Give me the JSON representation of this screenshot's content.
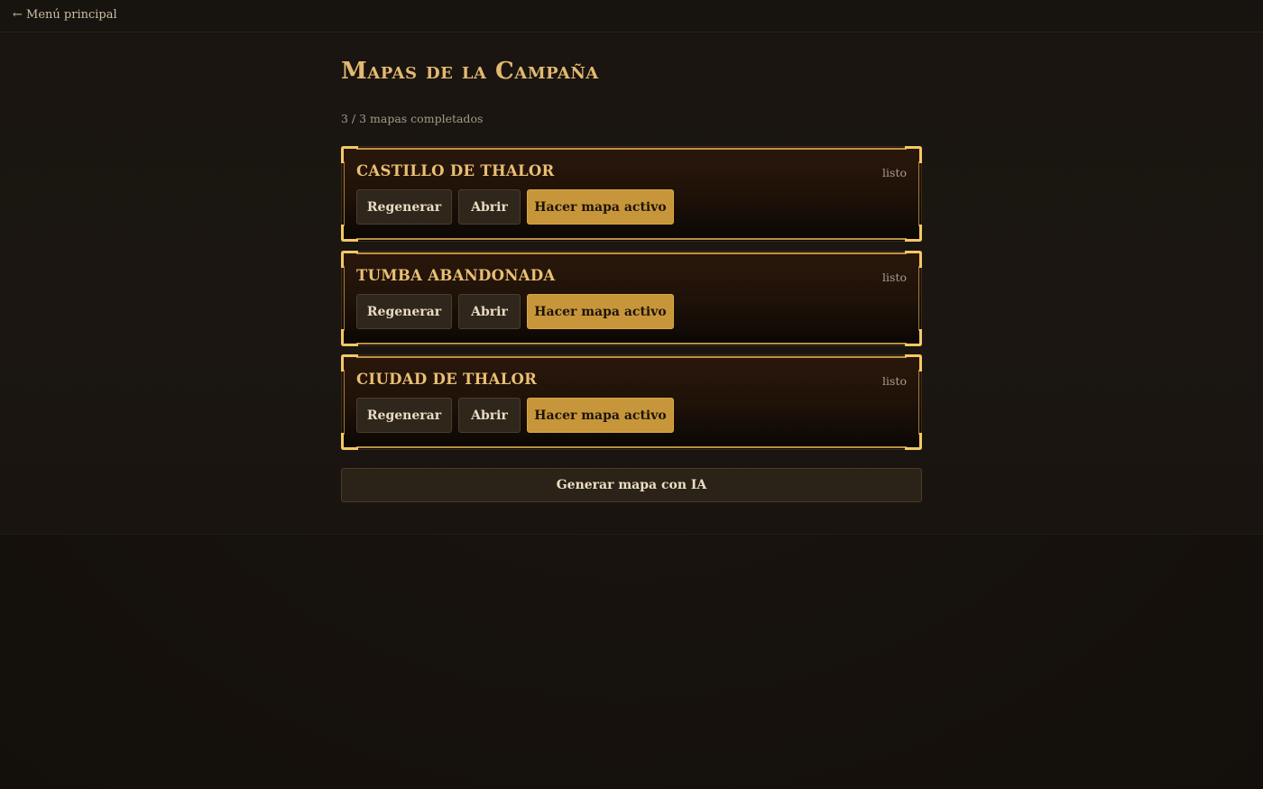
{
  "nav": {
    "back_label": "← Menú principal"
  },
  "header": {
    "title": "Mapas de la Campaña",
    "progress": "3 / 3 mapas completados"
  },
  "maps": [
    {
      "name": "CASTILLO DE THALOR",
      "status": "listo",
      "regenerate_label": "Regenerar",
      "open_label": "Abrir",
      "activate_label": "Hacer mapa activo"
    },
    {
      "name": "TUMBA ABANDONADA",
      "status": "listo",
      "regenerate_label": "Regenerar",
      "open_label": "Abrir",
      "activate_label": "Hacer mapa activo"
    },
    {
      "name": "CIUDAD DE THALOR",
      "status": "listo",
      "regenerate_label": "Regenerar",
      "open_label": "Abrir",
      "activate_label": "Hacer mapa activo"
    }
  ],
  "actions": {
    "generate_label": "Generar mapa con IA"
  },
  "colors": {
    "accent": "#c8963a",
    "frame": "#f4c866",
    "title": "#e3b970",
    "background": "#15110c"
  }
}
